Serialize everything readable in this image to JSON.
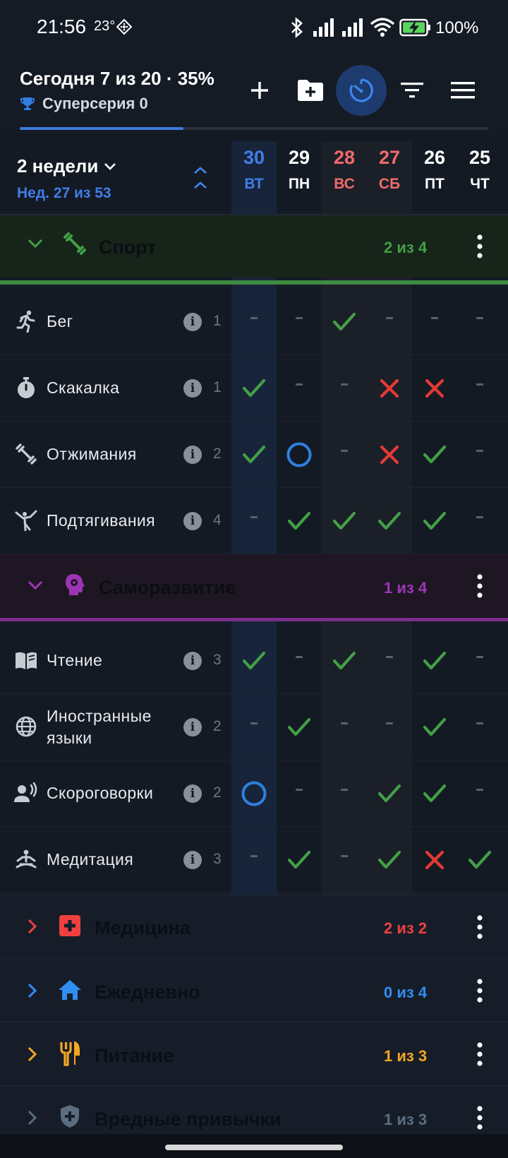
{
  "status_bar": {
    "time": "21:56",
    "temperature": "23°",
    "battery": "100%"
  },
  "header": {
    "title": "Сегодня 7 из 20 · 35%",
    "superseries": "Суперсерия 0",
    "progress": 0.35
  },
  "date_header": {
    "period": "2 недели",
    "week": "Нед. 27 из 53",
    "days": [
      {
        "num": "30",
        "name": "ВТ",
        "color": "#3f7ee8"
      },
      {
        "num": "29",
        "name": "ПН",
        "color": "#ffffff"
      },
      {
        "num": "28",
        "name": "ВС",
        "color": "#f06b6b"
      },
      {
        "num": "27",
        "name": "СБ",
        "color": "#f06b6b"
      },
      {
        "num": "26",
        "name": "ПТ",
        "color": "#ffffff"
      },
      {
        "num": "25",
        "name": "ЧТ",
        "color": "#ffffff"
      }
    ]
  },
  "groups": {
    "sport": {
      "title": "Спорт",
      "count": "2 из 4",
      "color": "#43a047",
      "habits": [
        {
          "icon": "running-icon",
          "label": "Бег",
          "goal": "1",
          "marks": [
            "dash",
            "dash",
            "check",
            "dash",
            "dash",
            "dash"
          ]
        },
        {
          "icon": "stopwatch-icon",
          "label": "Скакалка",
          "goal": "1",
          "marks": [
            "check",
            "dash",
            "dash",
            "cross",
            "cross",
            "dash"
          ]
        },
        {
          "icon": "dumbbell-icon",
          "label": "Отжимания",
          "goal": "2",
          "marks": [
            "check",
            "circle",
            "dash",
            "cross",
            "check",
            "dash"
          ]
        },
        {
          "icon": "gymnastics-icon",
          "label": "Подтягивания",
          "goal": "4",
          "marks": [
            "dash",
            "check",
            "check",
            "check",
            "check",
            "dash"
          ]
        }
      ]
    },
    "selfdev": {
      "title": "Саморазвитие",
      "count": "1 из 4",
      "color": "#9c35b5",
      "habits": [
        {
          "icon": "book-icon",
          "label": "Чтение",
          "goal": "3",
          "marks": [
            "check",
            "dash",
            "check",
            "dash",
            "check",
            "dash"
          ]
        },
        {
          "icon": "globe-icon",
          "label": "Иностранные языки",
          "label_line1": "Иностранные",
          "label_line2": "языки",
          "goal": "2",
          "marks": [
            "dash",
            "check",
            "dash",
            "dash",
            "check",
            "dash"
          ]
        },
        {
          "icon": "speaking-icon",
          "label": "Скороговорки",
          "goal": "2",
          "marks": [
            "circle",
            "dash",
            "dash",
            "check",
            "check",
            "dash"
          ]
        },
        {
          "icon": "meditation-icon",
          "label": "Медитация",
          "goal": "3",
          "marks": [
            "dash",
            "check",
            "dash",
            "check",
            "cross",
            "check"
          ]
        }
      ]
    },
    "medicine": {
      "title": "Медицина",
      "count": "2 из 2",
      "color": "#ef4040"
    },
    "daily": {
      "title": "Ежедневно",
      "count": "0 из 4",
      "color": "#2f8ff0"
    },
    "food": {
      "title": "Питание",
      "count": "1 из 3",
      "color": "#f5a623"
    },
    "bad_habits": {
      "title": "Вредные привычки",
      "count": "1 из 3",
      "color": "#5b6d80"
    }
  },
  "colors": {
    "check": "#43a047",
    "cross": "#e53935",
    "circle": "#2f7fe0",
    "accent": "#3d7bdc"
  }
}
